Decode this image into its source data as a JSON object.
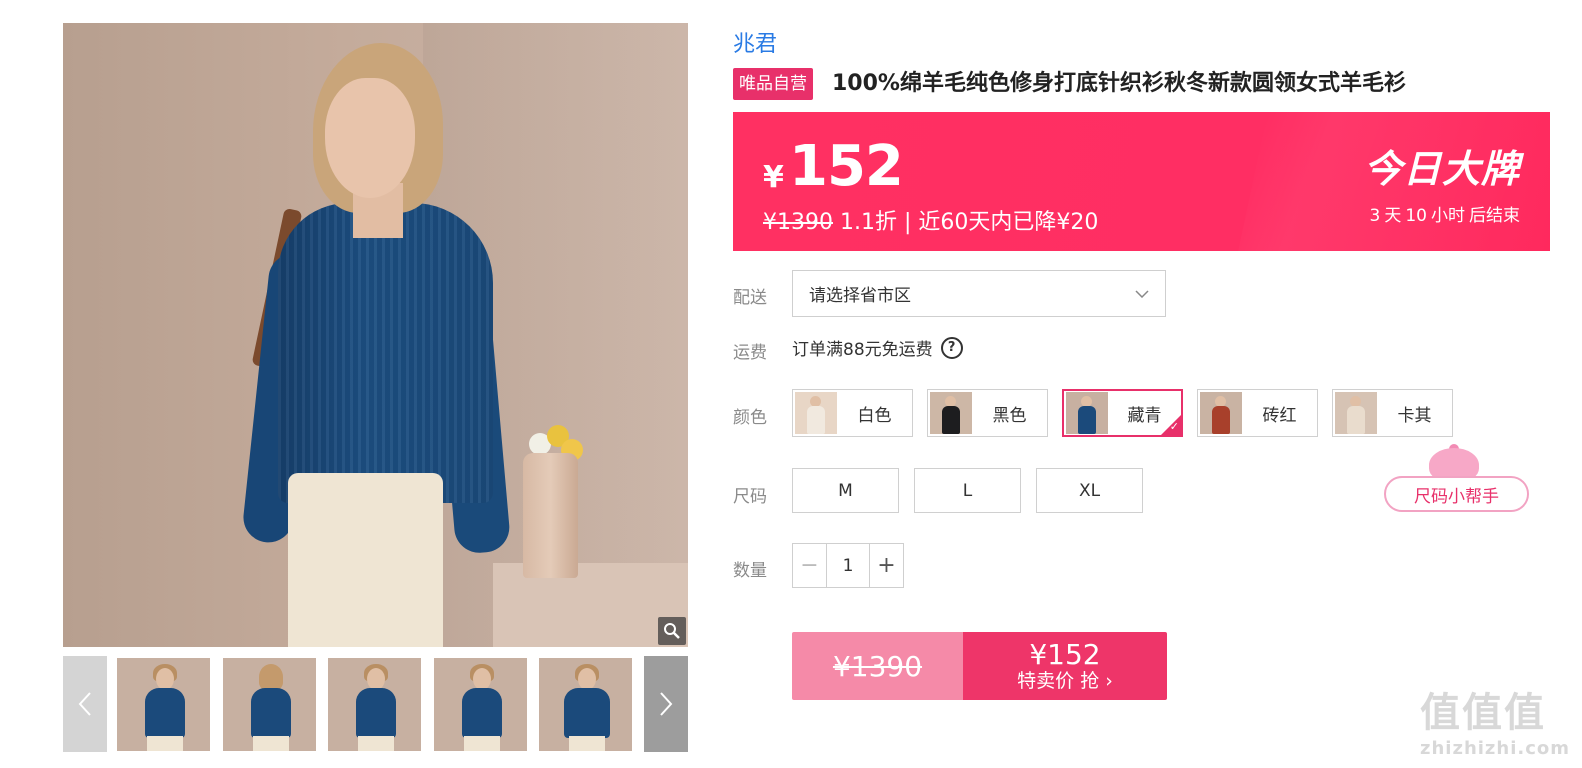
{
  "gallery": {
    "thumbnail_count": 5
  },
  "product": {
    "brand": "兆君",
    "self_badge": "唯品自营",
    "title": "100%绵羊毛纯色修身打底针织衫秋冬新款圆领女式羊毛衫"
  },
  "price_banner": {
    "currency": "¥",
    "price": "152",
    "original_price": "¥1390",
    "discount_info": "1.1折 | 近60天内已降¥20",
    "promo_name": "今日大牌",
    "countdown": {
      "days": "3",
      "days_unit": "天",
      "hours": "10",
      "hours_unit": "小时",
      "suffix": "后结束"
    }
  },
  "delivery": {
    "label": "配送",
    "placeholder": "请选择省市区"
  },
  "freight": {
    "label": "运费",
    "text": "订单满88元免运费",
    "help_glyph": "?"
  },
  "colors": {
    "label": "颜色",
    "options": [
      {
        "name": "白色",
        "swatch": "#f1e9df"
      },
      {
        "name": "黑色",
        "swatch": "#1d1d1f"
      },
      {
        "name": "藏青",
        "swatch": "#1b4a7b"
      },
      {
        "name": "砖红",
        "swatch": "#a8402b"
      },
      {
        "name": "卡其",
        "swatch": "#d9c7b3"
      }
    ],
    "selected": "藏青"
  },
  "sizes": {
    "label": "尺码",
    "options": [
      "M",
      "L",
      "XL"
    ],
    "helper": "尺码小帮手"
  },
  "quantity": {
    "label": "数量",
    "value": "1",
    "minus": "−",
    "plus": "+"
  },
  "buy": {
    "original_price": "¥1390",
    "price": "¥152",
    "action": "特卖价 抢 ›"
  },
  "watermark": {
    "glyphs": "值值值",
    "site": "zhizhizhi.com"
  },
  "theme": {
    "accent": "#e8306a",
    "banner": "#ff2e63",
    "link": "#2a7be4"
  }
}
